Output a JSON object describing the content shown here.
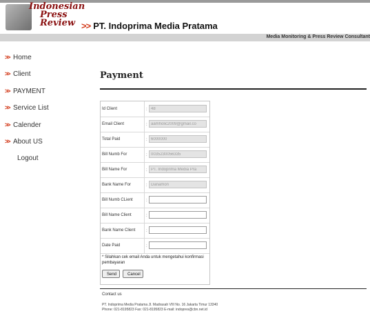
{
  "header": {
    "logo_lines": [
      "Indonesian",
      "Press",
      "Review"
    ],
    "arrows": ">>",
    "company": "PT. Indoprima Media Pratama",
    "tagline": "Media Monitoring & Press Review Consultant"
  },
  "nav": {
    "bullet": ">>",
    "items": [
      "Home",
      "Client",
      "PAYMENT",
      "Service List",
      "Calender",
      "About US"
    ],
    "logout": "Logout"
  },
  "page": {
    "title": "Payment"
  },
  "form": {
    "rows": [
      {
        "label": "Id Client",
        "value": "48",
        "readonly": true
      },
      {
        "label": "Email Client",
        "value": "aamholic2009@gmail.co",
        "readonly": true
      },
      {
        "label": "Total Paid",
        "value": "6000000",
        "readonly": true
      },
      {
        "label": "Bill Numb For",
        "value": "0035230056335",
        "readonly": true
      },
      {
        "label": "Bill Name For",
        "value": "PT. Indoprima Media Pra",
        "readonly": true
      },
      {
        "label": "Bank Name For",
        "value": "Danamon",
        "readonly": true
      },
      {
        "label": "Bill Numb CLient",
        "value": "",
        "readonly": false
      },
      {
        "label": "Bill Name Client",
        "value": "",
        "readonly": false
      },
      {
        "label": "Bank Name Client",
        "value": "",
        "readonly": false
      },
      {
        "label": "Date Paid",
        "value": "",
        "readonly": false
      }
    ],
    "colon": ":",
    "note": "* Silahkan cek email Anda untuk mengetahui konfirmasi pembayaran",
    "send_label": "Send",
    "cancel_label": "Cancel"
  },
  "footer": {
    "contact": "Contact us",
    "address_line1": "PT. Indoprima Media Pratama Jl. Madrasah VIII No. 16 Jakarta Timur 13340",
    "address_line2": "Phone: 021-8195823 Fax: 021-8195823 E-mail: indopres@cbn.net.id"
  }
}
